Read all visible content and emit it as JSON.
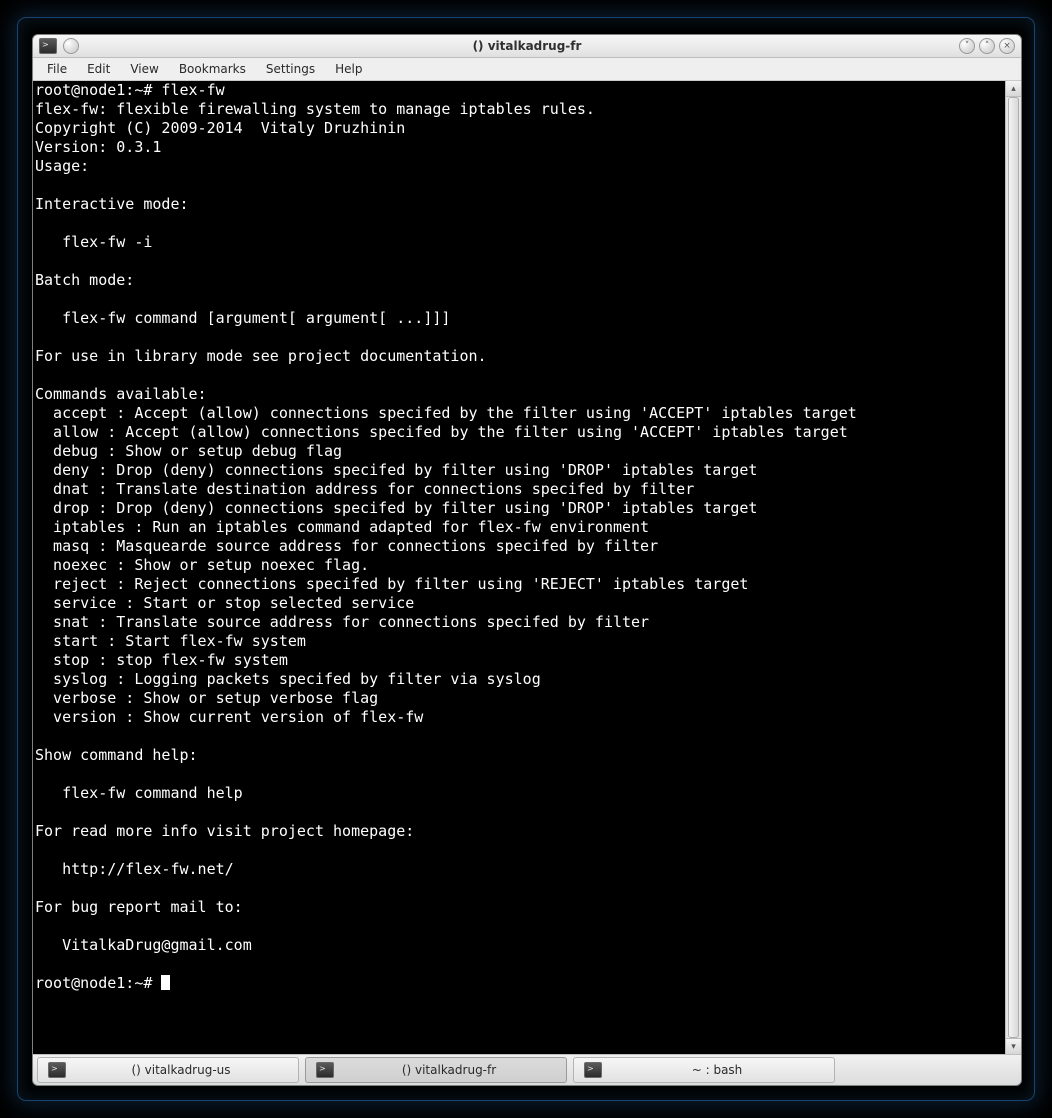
{
  "window": {
    "title": "() vitalkadrug-fr"
  },
  "menu": {
    "file": "File",
    "edit": "Edit",
    "view": "View",
    "bookmarks": "Bookmarks",
    "settings": "Settings",
    "help": "Help"
  },
  "terminal": {
    "prompt1": "root@node1:~# flex-fw",
    "line_desc": "flex-fw: flexible firewalling system to manage iptables rules.",
    "line_copy": "Copyright (C) 2009-2014  Vitaly Druzhinin",
    "line_ver": "Version: 0.3.1",
    "line_usage": "Usage:",
    "line_int_hdr": "Interactive mode:",
    "line_int_cmd": "   flex-fw -i",
    "line_batch_hdr": "Batch mode:",
    "line_batch_cmd": "   flex-fw command [argument[ argument[ ...]]]",
    "line_lib": "For use in library mode see project documentation.",
    "line_cmds_hdr": "Commands available:",
    "cmd_accept": "  accept : Accept (allow) connections specifed by the filter using 'ACCEPT' iptables target",
    "cmd_allow": "  allow : Accept (allow) connections specifed by the filter using 'ACCEPT' iptables target",
    "cmd_debug": "  debug : Show or setup debug flag",
    "cmd_deny": "  deny : Drop (deny) connections specifed by filter using 'DROP' iptables target",
    "cmd_dnat": "  dnat : Translate destination address for connections specifed by filter",
    "cmd_drop": "  drop : Drop (deny) connections specifed by filter using 'DROP' iptables target",
    "cmd_iptables": "  iptables : Run an iptables command adapted for flex-fw environment",
    "cmd_masq": "  masq : Masquearde source address for connections specifed by filter",
    "cmd_noexec": "  noexec : Show or setup noexec flag.",
    "cmd_reject": "  reject : Reject connections specifed by filter using 'REJECT' iptables target",
    "cmd_service": "  service : Start or stop selected service",
    "cmd_snat": "  snat : Translate source address for connections specifed by filter",
    "cmd_start": "  start : Start flex-fw system",
    "cmd_stop": "  stop : stop flex-fw system",
    "cmd_syslog": "  syslog : Logging packets specifed by filter via syslog",
    "cmd_verbose": "  verbose : Show or setup verbose flag",
    "cmd_version": "  version : Show current version of flex-fw",
    "line_help_hdr": "Show command help:",
    "line_help_cmd": "   flex-fw command help",
    "line_home_hdr": "For read more info visit project homepage:",
    "line_home_url": "   http://flex-fw.net/",
    "line_bug_hdr": "For bug report mail to:",
    "line_bug_mail": "   VitalkaDrug@gmail.com",
    "prompt2": "root@node1:~# "
  },
  "taskbar": {
    "items": [
      {
        "label": "() vitalkadrug-us",
        "active": false
      },
      {
        "label": "() vitalkadrug-fr",
        "active": true
      },
      {
        "label": "~ : bash",
        "active": false
      }
    ]
  }
}
